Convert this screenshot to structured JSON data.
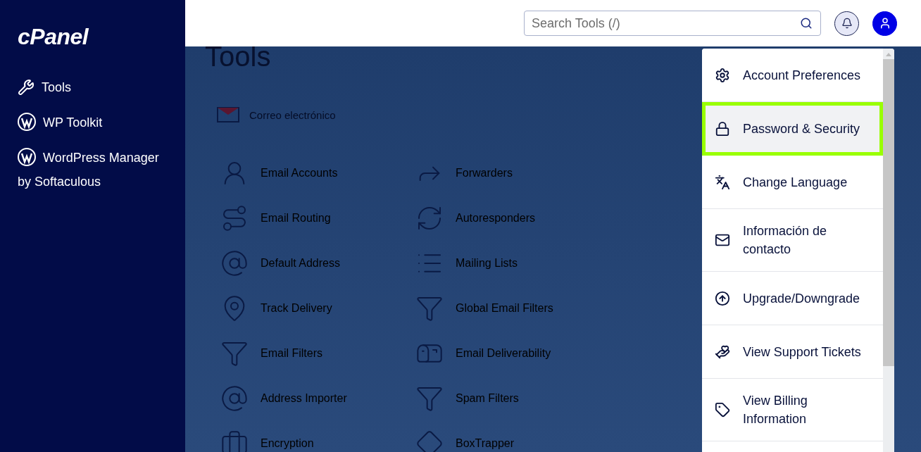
{
  "sidebar": {
    "logo": "cPanel",
    "items": [
      {
        "label": "Tools"
      },
      {
        "label": "WP Toolkit"
      },
      {
        "label": "WordPress Manager by Softaculous"
      }
    ]
  },
  "topbar": {
    "search": {
      "placeholder": "Search Tools (/)"
    }
  },
  "main": {
    "title": "Tools",
    "section": {
      "title": "Correo electrónico",
      "tools": [
        {
          "label": "Email Accounts"
        },
        {
          "label": "Forwarders"
        },
        {
          "label": "Email Routing"
        },
        {
          "label": "Autoresponders"
        },
        {
          "label": "Default Address"
        },
        {
          "label": "Mailing Lists"
        },
        {
          "label": "Track Delivery"
        },
        {
          "label": "Global Email Filters"
        },
        {
          "label": "Email Filters"
        },
        {
          "label": "Email Deliverability"
        },
        {
          "label": "Address Importer"
        },
        {
          "label": "Spam Filters"
        },
        {
          "label": "Encryption"
        },
        {
          "label": "BoxTrapper"
        }
      ]
    }
  },
  "user_menu": {
    "items": [
      {
        "label": "Account Preferences",
        "selected": false
      },
      {
        "label": "Password & Security",
        "selected": true
      },
      {
        "label": "Change Language",
        "selected": false
      },
      {
        "label": "Información de contacto",
        "selected": false
      },
      {
        "label": "Upgrade/Downgrade",
        "selected": false
      },
      {
        "label": "View Support Tickets",
        "selected": false
      },
      {
        "label": "View Billing Information",
        "selected": false
      }
    ]
  }
}
